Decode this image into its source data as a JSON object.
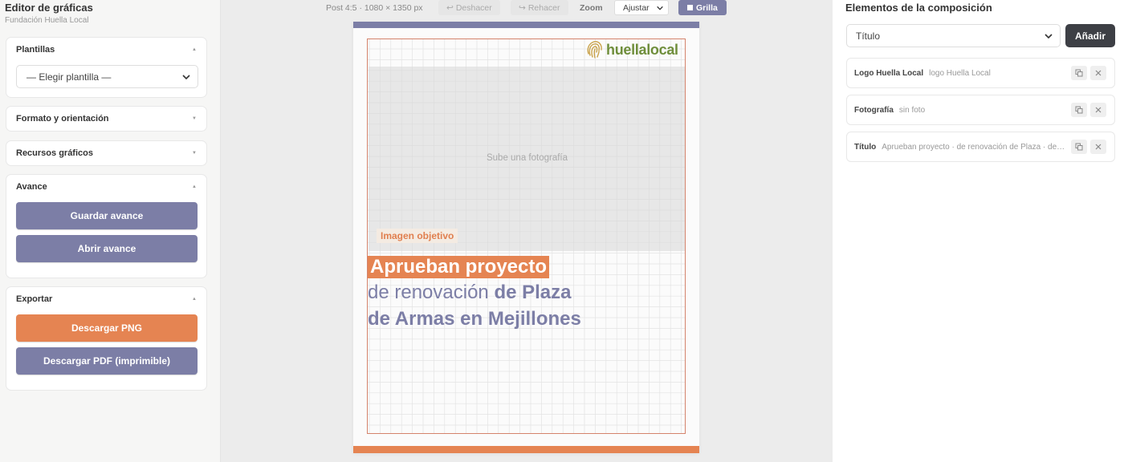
{
  "sidebar": {
    "title": "Editor de gráficas",
    "subtitle": "Fundación Huella Local",
    "sections": {
      "plantillas": {
        "label": "Plantillas",
        "select_value": "— Elegir plantilla —"
      },
      "formato": {
        "label": "Formato y orientación"
      },
      "recursos": {
        "label": "Recursos gráficos"
      },
      "avance": {
        "label": "Avance",
        "save": "Guardar avance",
        "open": "Abrir avance"
      },
      "exportar": {
        "label": "Exportar",
        "png": "Descargar PNG",
        "pdf": "Descargar PDF (imprimible)"
      }
    }
  },
  "toolbar": {
    "format_info": "Post 4:5 · 1080 × 1350 px",
    "undo": "Deshacer",
    "redo": "Rehacer",
    "zoom_label": "Zoom",
    "zoom_value": "Ajustar",
    "grid": "Grilla"
  },
  "canvas": {
    "logo_text": "huellalocal",
    "photo_placeholder": "Sube una fotografía",
    "tag": "Imagen objetivo",
    "title_highlight": "Aprueban proyecto",
    "title_line2_light": "de renovación ",
    "title_line2_bold": "de Plaza",
    "title_line3": "de Armas en Mejillones",
    "colors": {
      "purple": "#7c7ea6",
      "orange": "#e58452",
      "logo_green": "#6f8e3b"
    }
  },
  "elements_panel": {
    "title": "Elementos de la composición",
    "select_value": "Título",
    "add": "Añadir",
    "items": [
      {
        "name": "Logo Huella Local",
        "desc": "logo Huella Local"
      },
      {
        "name": "Fotografía",
        "desc": "sin foto"
      },
      {
        "name": "Título",
        "desc": "Aprueban proyecto · de renovación de Plaza · de Armas en Mejillones"
      }
    ]
  }
}
